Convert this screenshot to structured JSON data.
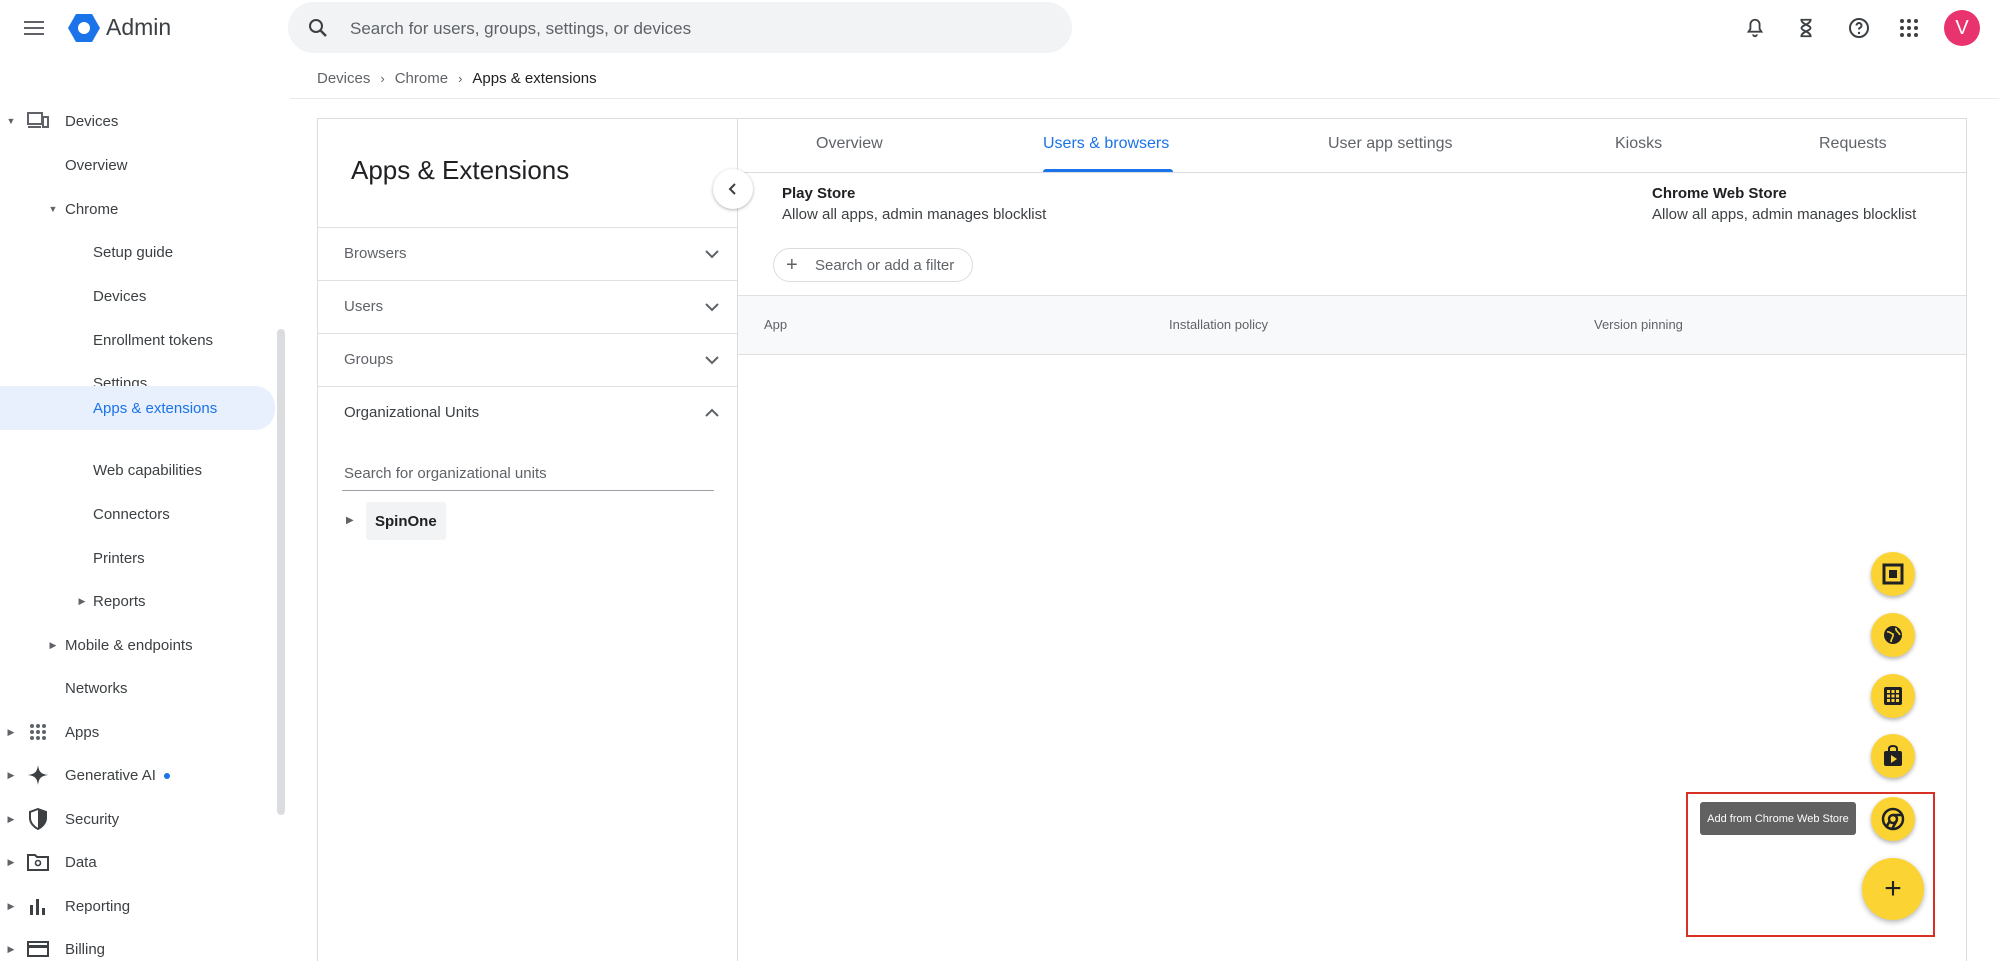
{
  "header": {
    "app_name": "Admin",
    "search_placeholder": "Search for users, groups, settings, or devices",
    "avatar_letter": "V"
  },
  "sidebar": {
    "items": [
      {
        "label": "Devices"
      },
      {
        "label": "Overview"
      },
      {
        "label": "Chrome"
      },
      {
        "label": "Setup guide"
      },
      {
        "label": "Devices"
      },
      {
        "label": "Enrollment tokens"
      },
      {
        "label": "Settings"
      },
      {
        "label": "Apps & extensions"
      },
      {
        "label": "Web capabilities"
      },
      {
        "label": "Connectors"
      },
      {
        "label": "Printers"
      },
      {
        "label": "Reports"
      },
      {
        "label": "Mobile & endpoints"
      },
      {
        "label": "Networks"
      },
      {
        "label": "Apps"
      },
      {
        "label": "Generative AI"
      },
      {
        "label": "Security"
      },
      {
        "label": "Data"
      },
      {
        "label": "Reporting"
      },
      {
        "label": "Billing"
      }
    ]
  },
  "breadcrumb": [
    "Devices",
    "Chrome",
    "Apps & extensions"
  ],
  "left_panel": {
    "title": "Apps & Extensions",
    "filters": [
      "Browsers",
      "Users",
      "Groups",
      "Organizational Units"
    ],
    "ou_search_placeholder": "Search for organizational units",
    "ou_root": "SpinOne"
  },
  "main": {
    "tabs": [
      "Overview",
      "Users & browsers",
      "User app settings",
      "Kiosks",
      "Requests"
    ],
    "active_tab": "Users & browsers",
    "play_store": {
      "title": "Play Store",
      "subtitle": "Allow all apps, admin manages blocklist"
    },
    "chrome_web_store": {
      "title": "Chrome Web Store",
      "subtitle": "Allow all apps, admin manages blocklist"
    },
    "filter_chip": "Search or add a filter",
    "columns": [
      "App",
      "Installation policy",
      "Version pinning"
    ]
  },
  "fab": {
    "tooltip": "Add from Chrome Web Store",
    "main_label": "+"
  },
  "colors": {
    "accent": "#1a73e8",
    "fab": "#fbd433",
    "avatar": "#e8336f",
    "highlight": "#d93025"
  }
}
